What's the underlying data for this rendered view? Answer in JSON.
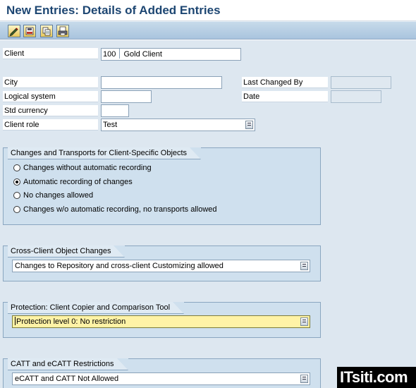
{
  "title": "New Entries: Details of Added Entries",
  "toolbar": {
    "buttons": [
      {
        "icon": "edit-pencil-icon"
      },
      {
        "icon": "save-local-icon"
      },
      {
        "icon": "copy-icon"
      },
      {
        "icon": "print-icon"
      }
    ]
  },
  "fields": {
    "client": {
      "label": "Client",
      "number": "100",
      "name": "Gold Client"
    },
    "city": {
      "label": "City",
      "value": ""
    },
    "logical_system": {
      "label": "Logical system",
      "value": ""
    },
    "std_currency": {
      "label": "Std currency",
      "value": ""
    },
    "client_role": {
      "label": "Client role",
      "value": "Test"
    },
    "last_changed_by": {
      "label": "Last Changed By",
      "value": ""
    },
    "date": {
      "label": "Date",
      "value": ""
    }
  },
  "changes_transports": {
    "title": "Changes and Transports for Client-Specific Objects",
    "options": [
      {
        "label": "Changes without automatic recording",
        "selected": false
      },
      {
        "label": "Automatic recording of changes",
        "selected": true
      },
      {
        "label": "No changes allowed",
        "selected": false
      },
      {
        "label": "Changes w/o automatic recording, no transports allowed",
        "selected": false
      }
    ]
  },
  "cross_client": {
    "title": "Cross-Client Object Changes",
    "value": "Changes to Repository and cross-client Customizing allowed"
  },
  "protection": {
    "title": "Protection: Client Copier and Comparison Tool",
    "value": "Protection level 0: No restriction"
  },
  "catt": {
    "title": "CATT and eCATT Restrictions",
    "value": "eCATT and CATT Not Allowed"
  },
  "watermark": "ITsiti.com"
}
